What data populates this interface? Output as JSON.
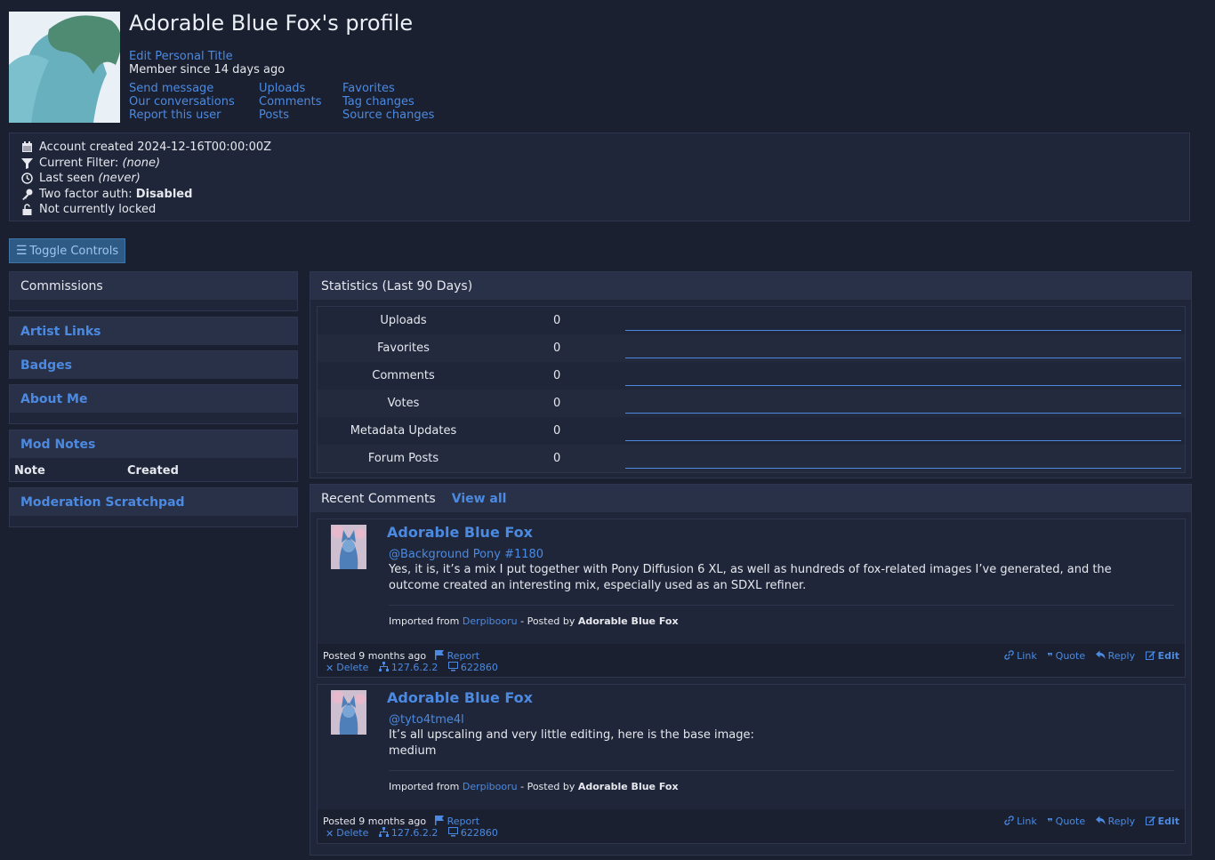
{
  "profile": {
    "title": "Adorable Blue Fox's profile",
    "edit_title": "Edit Personal Title",
    "member_since": "Member since 14 days ago",
    "links_col1": [
      "Send message",
      "Our conversations",
      "Report this user"
    ],
    "links_col2": [
      "Uploads",
      "Comments",
      "Posts"
    ],
    "links_col3": [
      "Favorites",
      "Tag changes",
      "Source changes"
    ]
  },
  "info": {
    "account_created": "Account created 2024-12-16T00:00:00Z",
    "filter_label": "Current Filter: ",
    "filter_value": "(none)",
    "last_seen_label": "Last seen ",
    "last_seen_value": "(never)",
    "two_factor_label": "Two factor auth: ",
    "two_factor_value": "Disabled",
    "lock_status": "Not currently locked"
  },
  "toggle_label": "Toggle Controls",
  "sidebar": {
    "commissions": "Commissions",
    "artist_links": "Artist Links",
    "badges": "Badges",
    "about_me": "About Me",
    "mod_notes": "Mod Notes",
    "mod_notes_col_note": "Note",
    "mod_notes_col_created": "Created",
    "moderation_scratchpad": "Moderation Scratchpad"
  },
  "stats": {
    "title": "Statistics (Last 90 Days)",
    "rows": [
      {
        "label": "Uploads",
        "value": "0"
      },
      {
        "label": "Favorites",
        "value": "0"
      },
      {
        "label": "Comments",
        "value": "0"
      },
      {
        "label": "Votes",
        "value": "0"
      },
      {
        "label": "Metadata Updates",
        "value": "0"
      },
      {
        "label": "Forum Posts",
        "value": "0"
      }
    ]
  },
  "recent": {
    "title": "Recent Comments",
    "view_all": "View all",
    "comments": [
      {
        "author": "Adorable Blue Fox",
        "mention": "@Background Pony #1180",
        "text": "Yes, it is, it’s a mix I put together with Pony Diffusion 6 XL, as well as hundreds of fox-related images I’ve generated, and the outcome created an interesting mix, especially used as an SDXL refiner.",
        "imported_prefix": "Imported from ",
        "imported_source": "Derpibooru",
        "posted_by_prefix": " - Posted by ",
        "posted_by": "Adorable Blue Fox",
        "posted": "Posted 9 months ago",
        "report": "Report",
        "delete": "Delete",
        "ip": "127.6.2.2",
        "fingerprint": "622860",
        "link": "Link",
        "quote": "Quote",
        "reply": "Reply",
        "edit": "Edit"
      },
      {
        "author": "Adorable Blue Fox",
        "mention": "@tyto4tme4l",
        "text": "It’s all upscaling and very little editing, here is the base image:",
        "text2": "medium",
        "imported_prefix": "Imported from ",
        "imported_source": "Derpibooru",
        "posted_by_prefix": " - Posted by ",
        "posted_by": "Adorable Blue Fox",
        "posted": "Posted 9 months ago",
        "report": "Report",
        "delete": "Delete",
        "ip": "127.6.2.2",
        "fingerprint": "622860",
        "link": "Link",
        "quote": "Quote",
        "reply": "Reply",
        "edit": "Edit"
      }
    ]
  },
  "colors": {
    "background": "#1b2031",
    "panel": "#1f2639",
    "panel_header": "#293149",
    "link": "#4b8ae0",
    "toggle_button": "#2d5b86"
  },
  "icons": [
    "calendar-icon",
    "filter-icon",
    "clock-icon",
    "key-icon",
    "unlock-icon",
    "bars-icon",
    "link-icon",
    "quote-icon",
    "reply-icon",
    "edit-icon",
    "flag-icon",
    "times-icon",
    "network-icon",
    "desktop-icon"
  ]
}
